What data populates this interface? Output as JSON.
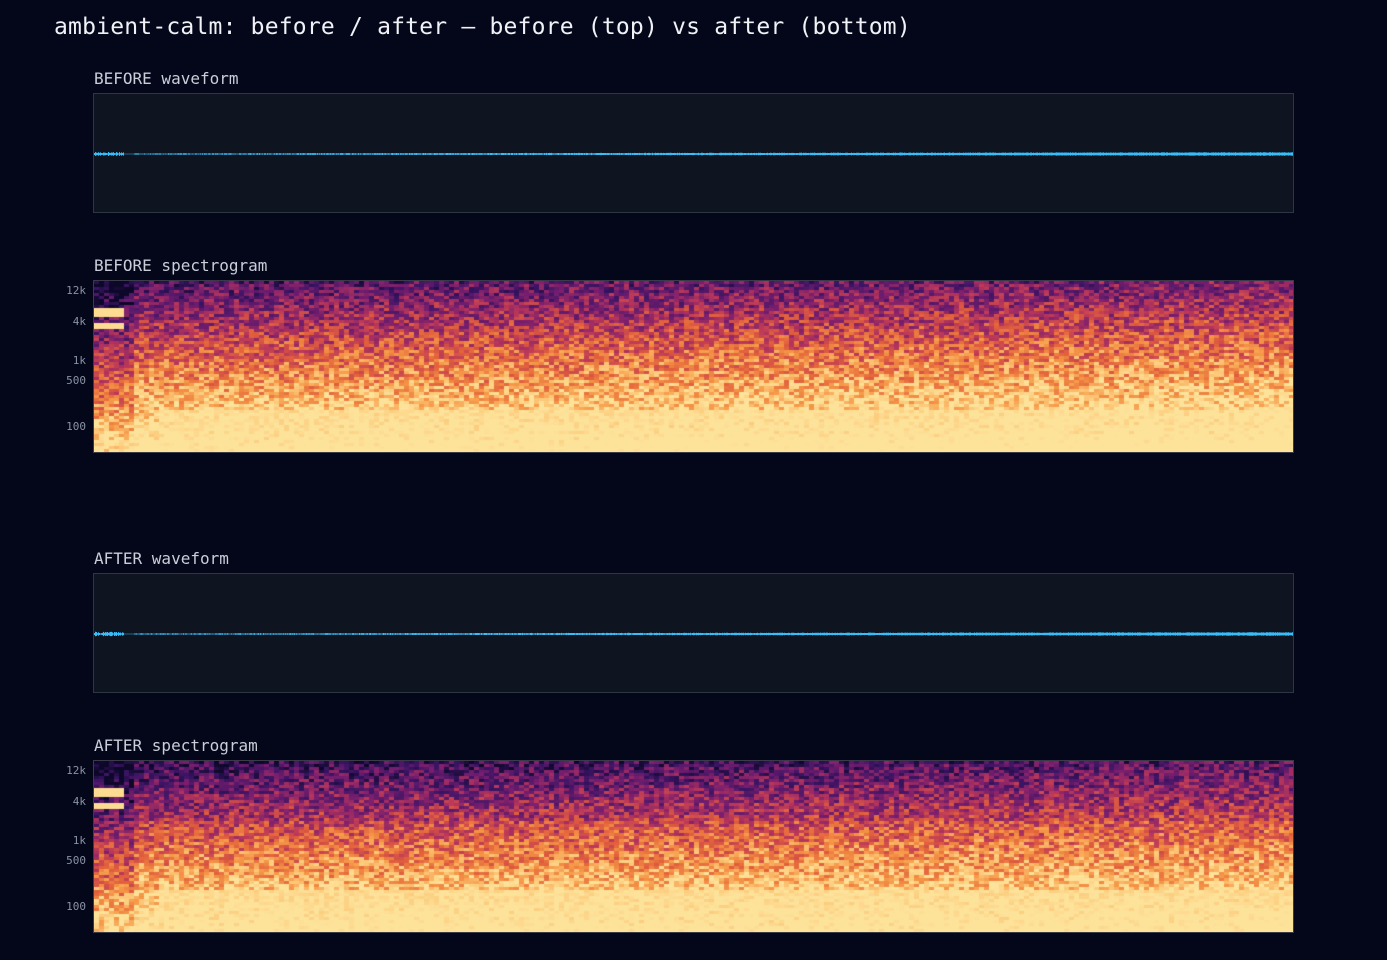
{
  "title": "ambient-calm: before / after — before (top) vs after (bottom)",
  "before": {
    "waveform_label": "BEFORE waveform",
    "spectrogram_label": "BEFORE spectrogram"
  },
  "after": {
    "waveform_label": "AFTER waveform",
    "spectrogram_label": "AFTER spectrogram"
  },
  "frequency_ticks": [
    "12k",
    "4k",
    "1k",
    "500",
    "100"
  ],
  "colors": {
    "background": "#04061a",
    "waveform_panel": "#0e1420",
    "waveform_line": "#38bdf8",
    "spectrogram_low": "#0d0829",
    "spectrogram_high": "#fde29a"
  }
}
